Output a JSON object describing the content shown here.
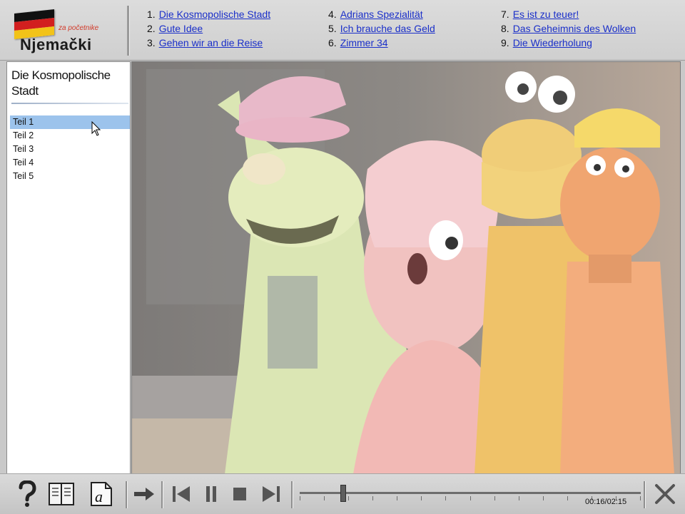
{
  "logo": {
    "subtitle": "za početnike",
    "title": "Njemački",
    "flag_colors": [
      "#111111",
      "#d21f1f",
      "#f2c318"
    ]
  },
  "chapters": [
    {
      "num": "1.",
      "title": "Die Kosmopolische Stadt"
    },
    {
      "num": "2.",
      "title": "Gute Idee"
    },
    {
      "num": "3.",
      "title": "Gehen wir an die Reise"
    },
    {
      "num": "4.",
      "title": "Adrians Spezialität"
    },
    {
      "num": "5.",
      "title": "Ich brauche das Geld"
    },
    {
      "num": "6.",
      "title": "Zimmer 34"
    },
    {
      "num": "7.",
      "title": "Es ist zu teuer!"
    },
    {
      "num": "8.",
      "title": "Das Geheimnis des Wolken"
    },
    {
      "num": "9.",
      "title": "Die Wiederholung"
    }
  ],
  "sidebar": {
    "title": "Die Kosmopolische Stadt",
    "parts": [
      "Teil 1",
      "Teil 2",
      "Teil 3",
      "Teil 4",
      "Teil 5"
    ],
    "selected_index": 0
  },
  "controls": {
    "icons": [
      "help-icon",
      "book-icon",
      "notes-icon",
      "forward-arrow-icon",
      "previous-icon",
      "pause-icon",
      "stop-icon",
      "next-icon",
      "close-icon"
    ],
    "elapsed_seconds": 16,
    "duration_seconds": 135,
    "time_text": "00:16/02:15"
  }
}
